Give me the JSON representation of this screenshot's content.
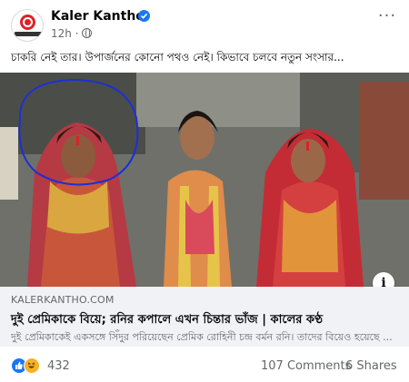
{
  "post": {
    "page_name": "Kaler Kantho",
    "time": "12h",
    "caption": "চাকরি নেই তার। উপার্জনের কোনো পথও নেই। কিভাবে চলবে নতুন সংসার..."
  },
  "icons": {
    "avatar": "kaler-kantho-logo",
    "verified": "verified-badge-icon",
    "privacy": "globe-icon",
    "more": "more-options-icon",
    "info": "info-icon",
    "reaction_1": "like-reaction-icon",
    "reaction_2": "haha-reaction-icon"
  },
  "link_preview": {
    "domain": "KALERKANTHO.COM",
    "title": "দুই প্রেমিকাকে বিয়ে; রনির কপালে এখন চিন্তার ভাঁজ | কালের কণ্ঠ",
    "description": "দুই প্রেমিকাকেই একসঙ্গে সিঁদুর পরিয়েছেন প্রেমিক রোহিনী চন্দ্র বর্মন রনি। তাদের বিয়েও হয়েছে ..."
  },
  "stats": {
    "reactions": "432",
    "comments": "107 Comments",
    "shares": "6 Shares"
  },
  "colors": {
    "accent": "#1877f2",
    "brand_red": "#d8232a",
    "muted_text": "#65676b",
    "link_bg": "#f0f2f5"
  }
}
